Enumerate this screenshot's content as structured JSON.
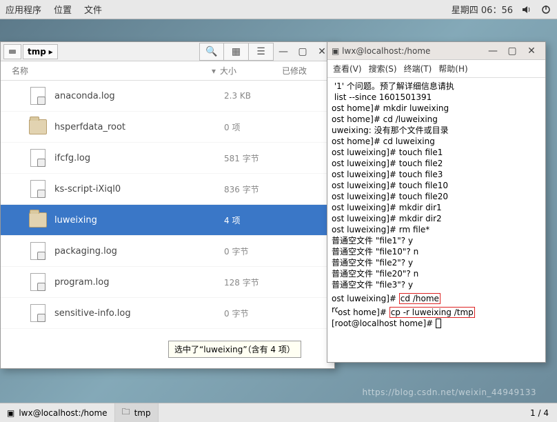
{
  "topbar": {
    "apps": "应用程序",
    "places": "位置",
    "files": "文件",
    "clock": "星期四 06：56"
  },
  "fm": {
    "crumb": "tmp",
    "cols": {
      "name": "名称",
      "size": "大小",
      "mod": "已修改"
    },
    "rows": [
      {
        "name": "anaconda.log",
        "size": "2.3 KB",
        "kind": "file"
      },
      {
        "name": "hsperfdata_root",
        "size": "0 项",
        "kind": "folder"
      },
      {
        "name": "ifcfg.log",
        "size": "581 字节",
        "kind": "file"
      },
      {
        "name": "ks-script-iXiql0",
        "size": "836 字节",
        "kind": "file"
      },
      {
        "name": "luweixing",
        "size": "4 项",
        "kind": "folder",
        "selected": true
      },
      {
        "name": "packaging.log",
        "size": "0 字节",
        "kind": "file"
      },
      {
        "name": "program.log",
        "size": "128 字节",
        "kind": "file"
      },
      {
        "name": "sensitive-info.log",
        "size": "0 字节",
        "kind": "file"
      }
    ],
    "tooltip": "选中了“luweixing”（含有 4 项）"
  },
  "term": {
    "title": "lwx@localhost:/home",
    "menus": {
      "view": "查看(V)",
      "search": "搜索(S)",
      "terminal": "终端(T)",
      "help": "帮助(H)"
    },
    "lines": [
      " '1' 个问题。预了解详细信息请执",
      " list --since 1601501391",
      "ost home]# mkdir luweixing",
      "ost home]# cd /luweixing",
      "uweixing: 没有那个文件或目录",
      "ost home]# cd luweixing",
      "ost luweixing]# touch file1",
      "ost luweixing]# touch file2",
      "ost luweixing]# touch file3",
      "ost luweixing]# touch file10",
      "ost luweixing]# touch file20",
      "ost luweixing]# mkdir dir1",
      "ost luweixing]# mkdir dir2",
      "ost luweixing]# rm file*",
      "普通空文件 \"file1\"? y",
      "普通空文件 \"file10\"? n",
      "普通空文件 \"file2\"? y",
      "普通空文件 \"file20\"? n",
      "普通空文件 \"file3\"? y"
    ],
    "hl1_pre": "ost luweixing]# ",
    "hl1_cmd": "cd /home",
    "hl2_pre_a": "root@localh",
    "hl2_pre_b": "ost home]# ",
    "hl2_cmd": "cp -r luweixing /tmp",
    "prompt": "[root@localhost home]# "
  },
  "taskbar": {
    "t1": "lwx@localhost:/home",
    "t2": "tmp",
    "ws": "1 / 4"
  },
  "watermark": "https://blog.csdn.net/weixin_44949133"
}
